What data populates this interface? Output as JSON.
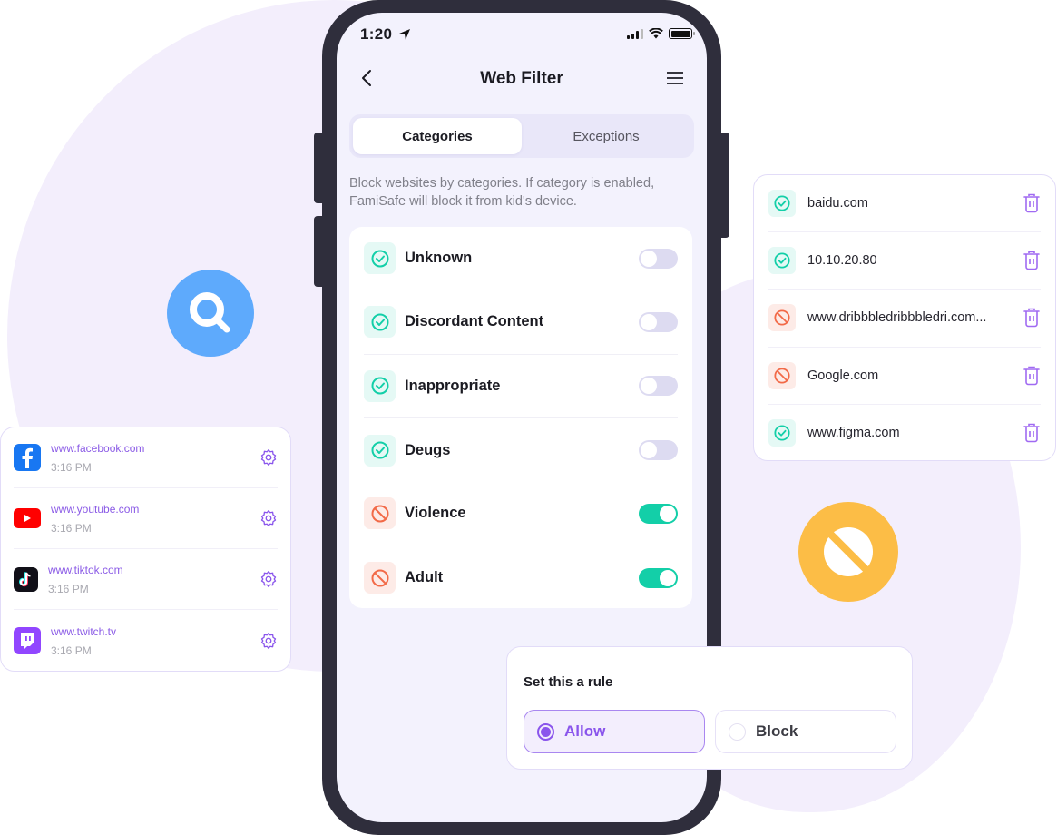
{
  "phone": {
    "status_time": "1:20",
    "nav_title": "Web Filter",
    "tabs": [
      {
        "label": "Categories",
        "active": true
      },
      {
        "label": "Exceptions",
        "active": false
      }
    ],
    "description": "Block websites by categories. If category is enabled, FamiSafe will block it from kid's device.",
    "categories": [
      {
        "label": "Unknown",
        "status": "allowed",
        "enabled": false
      },
      {
        "label": "Discordant Content",
        "status": "allowed",
        "enabled": false
      },
      {
        "label": "Inappropriate",
        "status": "allowed",
        "enabled": false
      },
      {
        "label": "Deugs",
        "status": "allowed",
        "enabled": false
      },
      {
        "label": "Violence",
        "status": "blocked",
        "enabled": true
      },
      {
        "label": "Adult",
        "status": "blocked",
        "enabled": true
      }
    ]
  },
  "sites": [
    {
      "url": "www.facebook.com",
      "time": "3:16 PM",
      "logo": "facebook"
    },
    {
      "url": "www.youtube.com",
      "time": "3:16 PM",
      "logo": "youtube"
    },
    {
      "url": "www.tiktok.com",
      "time": "3:16 PM",
      "logo": "tiktok"
    },
    {
      "url": "www.twitch.tv",
      "time": "3:16 PM",
      "logo": "twitch"
    }
  ],
  "exceptions": [
    {
      "url": "baidu.com",
      "status": "allowed"
    },
    {
      "url": "10.10.20.80",
      "status": "allowed"
    },
    {
      "url": "www.dribbbledribbbledri.com...",
      "status": "blocked"
    },
    {
      "url": "Google.com",
      "status": "blocked"
    },
    {
      "url": "www.figma.com",
      "status": "allowed"
    }
  ],
  "rule": {
    "title": "Set this a rule",
    "options": [
      {
        "label": "Allow",
        "selected": true
      },
      {
        "label": "Block",
        "selected": false
      }
    ]
  },
  "colors": {
    "accent": "#8a55ec",
    "allowed": "#13cfa8",
    "blocked": "#f26a48",
    "search_bubble": "#5eaafc",
    "block_bubble": "#fcbd46",
    "phone_frame": "#2f2e3c"
  }
}
